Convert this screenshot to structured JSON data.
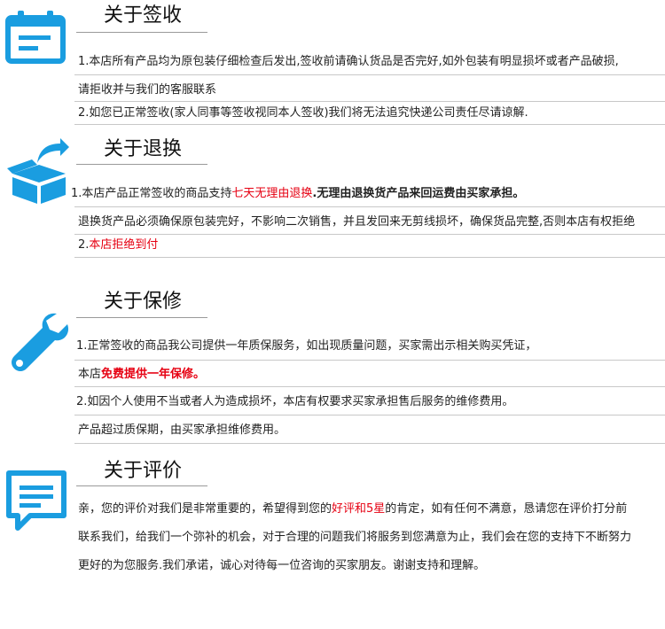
{
  "accent_color": "#1a9de0",
  "highlight_color": "#e60012",
  "sign": {
    "title": "关于签收",
    "icon": "calendar-icon",
    "lines": [
      "1.本店所有产品均为原包装仔细检查后发出,签收前请确认货品是否完好,如外包装有明显损坏或者产品破损,",
      "请拒收并与我们的客服联系",
      "2.如您已正常签收(家人同事等签收视同本人签收)我们将无法追究快递公司责任尽请谅解."
    ]
  },
  "returns": {
    "title": "关于退换",
    "icon": "return-box-icon",
    "line1_pre": "1.本店产品正常签收的商品支持",
    "line1_red": "七天无理由退换",
    "line1_post": ".无理由退换货产品来回运费由买家承担。",
    "line2": "退换货产品必须确保原包装完好，不影响二次销售，并且发回来无剪线损坏，确保货品完整,否则本店有权拒绝",
    "line3_pre": "2.",
    "line3_red": "本店拒绝到付"
  },
  "warranty": {
    "title": "关于保修",
    "icon": "wrench-icon",
    "line1": "1.正常签收的商品我公司提供一年质保服务，如出现质量问题，买家需出示相关购买凭证，",
    "line2_pre": "本店",
    "line2_red": "免费提供一年保修。",
    "line3": "2.如因个人使用不当或者人为造成损坏，本店有权要求买家承担售后服务的维修费用。",
    "line4": "产品超过质保期，由买家承担维修费用。"
  },
  "review": {
    "title": "关于评价",
    "icon": "chat-bubble-icon",
    "line1_pre": "亲，您的评价对我们是非常重要的，希望得到您的",
    "line1_red": "好评和5星",
    "line1_post": "的肯定，如有任何不满意，恳请您在评价打分前",
    "line2": "联系我们，给我们一个弥补的机会，对于合理的问题我们将服务到您满意为止，我们会在您的支持下不断努力",
    "line3": "更好的为您服务.我们承诺，诚心对待每一位咨询的买家朋友。谢谢支持和理解。"
  }
}
